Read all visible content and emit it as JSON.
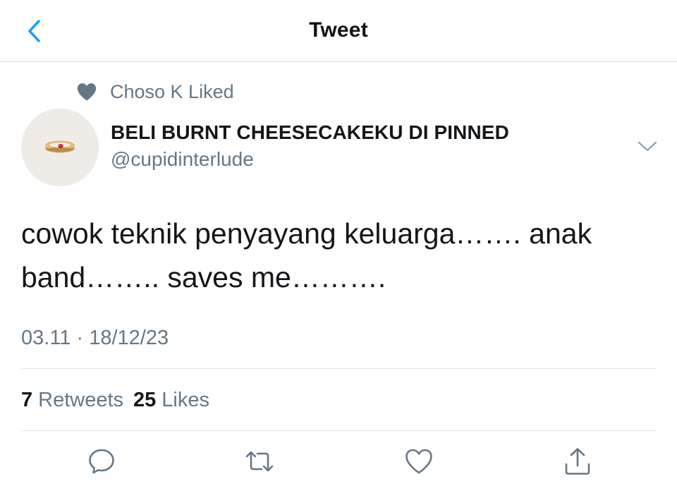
{
  "nav": {
    "title": "Tweet",
    "back_icon": "chevron-left-icon",
    "accent_color": "#1da1f2"
  },
  "social_context": {
    "icon": "heart-filled-icon",
    "text": "Choso K Liked"
  },
  "tweet": {
    "author": {
      "display_name": "BELI BURNT CHEESECAKEKU DI PINNED",
      "handle": "@cupidinterlude",
      "avatar": "ring-avatar"
    },
    "text": "cowok teknik penyayang keluarga……. anak band…….. saves me……….",
    "timestamp": "03.11 · 18/12/23"
  },
  "stats": {
    "retweets_count": "7",
    "retweets_label": "Retweets",
    "likes_count": "25",
    "likes_label": "Likes"
  },
  "actions": [
    "reply-icon",
    "retweet-icon",
    "like-icon",
    "share-icon"
  ],
  "colors": {
    "secondary_text": "#657786",
    "divider": "#dfe3e7",
    "icon": "#657786"
  }
}
